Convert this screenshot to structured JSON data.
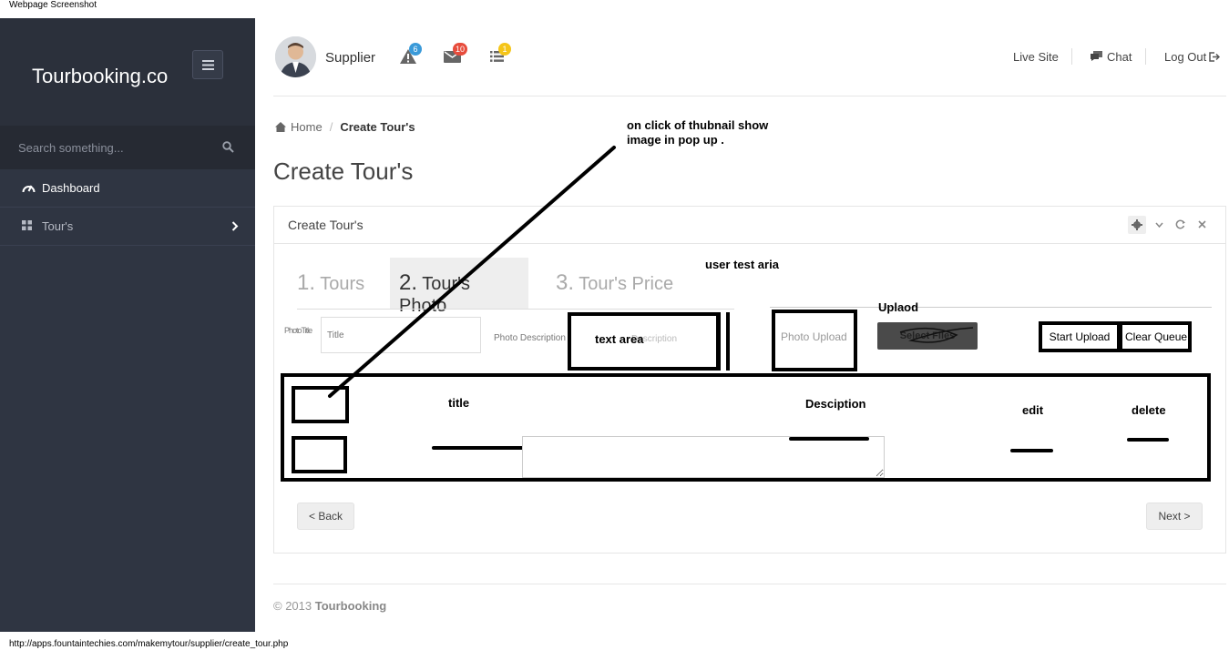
{
  "captions": {
    "top": "Webpage Screenshot",
    "bottom": "http://apps.fountaintechies.com/makemytour/supplier/create_tour.php"
  },
  "sidebar": {
    "brand": "Tourbooking.co",
    "search_placeholder": "Search something...",
    "items": [
      {
        "label": "Dashboard",
        "icon": "dashboard-icon"
      },
      {
        "label": "Tour's",
        "icon": "grid-icon"
      }
    ]
  },
  "header": {
    "user": "Supplier",
    "badges": {
      "alerts": "6",
      "messages": "10",
      "tasks": "1"
    },
    "links": {
      "live_site": "Live Site",
      "chat": "Chat",
      "logout": "Log Out"
    }
  },
  "breadcrumb": {
    "home": "Home",
    "current": "Create Tour's"
  },
  "page_title": "Create Tour's",
  "panel": {
    "title": "Create Tour's",
    "tabs": [
      {
        "num": "1.",
        "label": "Tours"
      },
      {
        "num": "2.",
        "label": "Tour's Photo"
      },
      {
        "num": "3.",
        "label": "Tour's Price"
      }
    ],
    "form": {
      "photo_title_label": "PhotoTitle",
      "title_placeholder": "Title",
      "photo_description_label": "Photo Description",
      "description_placeholder": "Description",
      "photo_upload": "Photo Upload",
      "select_files": "Select Files",
      "start_upload": "Start Upload",
      "clear_queue": "Clear Queue"
    },
    "back": "< Back",
    "next": "Next >"
  },
  "annotations": {
    "thumbnail_note_line1": "on click of thubnail show",
    "thumbnail_note_line2": "image in pop up .",
    "user_test": "user test aria",
    "upload": "Uplaod",
    "text_area": "text area",
    "col_title": "title",
    "col_description": "Desciption",
    "col_edit": "edit",
    "col_delete": "delete"
  },
  "footer": {
    "year": "© 2013",
    "brand": "Tourbooking"
  },
  "colors": {
    "sidebar": "#2f3542",
    "badge_blue": "#3a9ad9",
    "badge_red": "#e74c3c",
    "badge_yellow": "#f5c518"
  }
}
